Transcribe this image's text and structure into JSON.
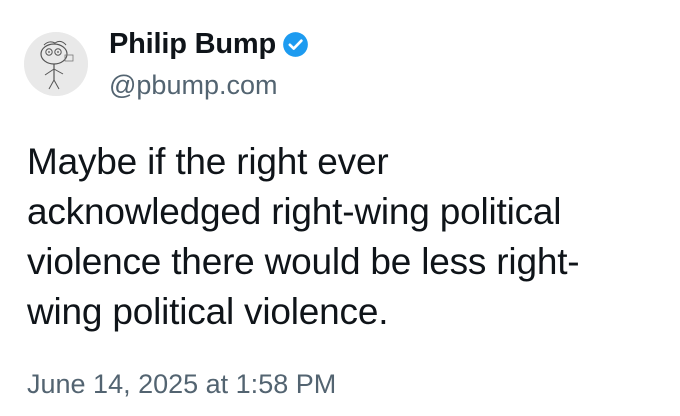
{
  "author": {
    "display_name": "Philip Bump",
    "handle": "@pbump.com",
    "avatar_icon": "hand-drawn-cartoon-avatar",
    "verified_icon": "verified-badge-icon",
    "verified_color": "#1d9bf0"
  },
  "post": {
    "text_lines": [
      "Maybe if the right ever",
      "acknowledged right-wing political",
      "violence there would be less right-",
      "wing political violence."
    ],
    "timestamp": "June 14, 2025 at 1:58 PM"
  },
  "colors": {
    "text_primary": "#0f1419",
    "text_secondary": "#536471",
    "background": "#ffffff"
  }
}
